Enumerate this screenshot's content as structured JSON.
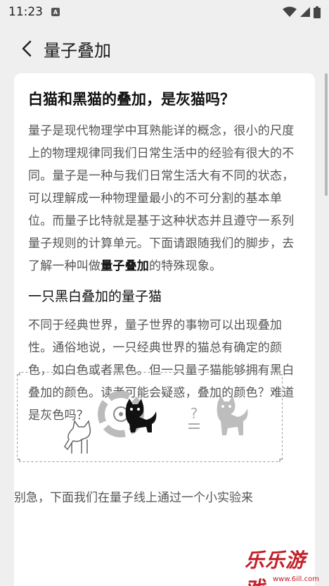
{
  "status": {
    "time": "11:23",
    "notif_badge": "A"
  },
  "header": {
    "title": "量子叠加"
  },
  "article": {
    "title": "白猫和黑猫的叠加，是灰猫吗？",
    "para1_before": "量子是现代物理学中耳熟能详的概念，很小的尺度上的物理规律同我们日常生活中的经验有很大的不同。量子是一种与我们日常生活大有不同的状态，可以理解成一种物理量最小的不可分割的基本单位。而量子比特就是基于这种状态并且遵守一系列量子规则的计算单元。下面请跟随我们的脚步，去了解一种叫做",
    "para1_bold": "量子叠加",
    "para1_after": "的特殊现象。",
    "section_title": "一只黑白叠加的量子猫",
    "para2": "不同于经典世界，量子世界的事物可以出现叠加性。通俗地说，一只经典世界的猫总有确定的颜色，如白色或者黑色。但一只量子猫能够拥有黑白叠加的颜色。读者可能会疑惑，叠加的颜色？难道是灰色吗？",
    "figure_question": "?",
    "next_text": "别急，下面我们在量子线上通过一个小实验来"
  },
  "watermark": {
    "text": "乐乐游戏",
    "url": "www.6ill.com"
  },
  "colors": {
    "background": "#efefef",
    "card": "#ffffff",
    "watermark": "#c3202a"
  }
}
